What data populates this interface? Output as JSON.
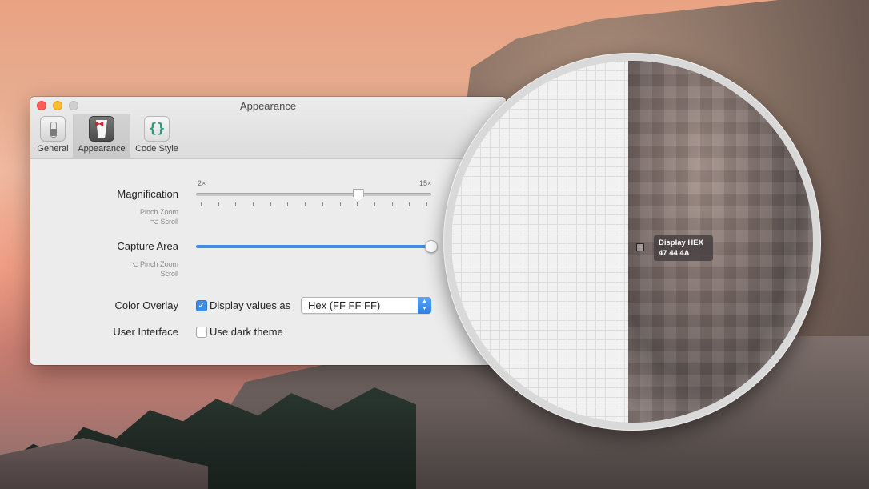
{
  "window": {
    "title": "Appearance",
    "toolbar": [
      {
        "label": "General",
        "icon": "switch-icon"
      },
      {
        "label": "Appearance",
        "icon": "tuxedo-icon",
        "selected": true
      },
      {
        "label": "Code Style",
        "icon": "braces-icon"
      }
    ]
  },
  "magnification": {
    "label": "Magnification",
    "hint_line1": "Pinch Zoom",
    "hint_line2": "⌥ Scroll",
    "min_label": "2×",
    "max_label": "15×",
    "value_fraction": 0.69
  },
  "capture_area": {
    "label": "Capture Area",
    "hint_line1": "⌥ Pinch Zoom",
    "hint_line2": "Scroll",
    "value_fraction": 1.0
  },
  "color_overlay": {
    "label": "Color Overlay",
    "checkbox_label": "Display values as",
    "checked": true,
    "format_selected": "Hex (FF FF FF)"
  },
  "user_interface": {
    "label": "User Interface",
    "checkbox_label": "Use dark theme",
    "checked": false
  },
  "loupe": {
    "readout_title": "Display HEX",
    "readout_value": "47 44 4A"
  },
  "colors": {
    "accent": "#3d8ee7",
    "close": "#fc5f57",
    "minimize": "#fdbc2e"
  }
}
